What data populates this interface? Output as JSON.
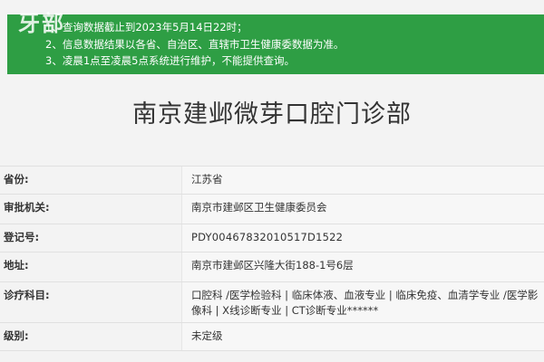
{
  "notice": {
    "lines": [
      "1、查询数据截止到2023年5月14日22时；",
      "2、信息数据结果以各省、自治区、直辖市卫生健康委数据为准。",
      "3、凌晨1点至凌晨5点系统进行维护，不能提供查询。"
    ],
    "watermark": "牙部"
  },
  "page_title": "南京建邺微芽口腔门诊部",
  "rows": [
    {
      "label": "省份:",
      "value": "江苏省"
    },
    {
      "label": "审批机关:",
      "value": "南京市建邺区卫生健康委员会"
    },
    {
      "label": "登记号:",
      "value": "PDY00467832010517D1522"
    },
    {
      "label": "地址:",
      "value": "南京市建邺区兴隆大街188-1号6层"
    },
    {
      "label": "诊疗科目:",
      "value": "口腔科 /医学检验科 | 临床体液、血液专业 | 临床免疫、血清学专业 /医学影像科 | X线诊断专业 | CT诊断专业******"
    },
    {
      "label": "级别:",
      "value": "未定级"
    }
  ],
  "colors": {
    "notice_bg": "#2e9e44",
    "page_bg": "#f3f3f3",
    "text": "#333333"
  }
}
